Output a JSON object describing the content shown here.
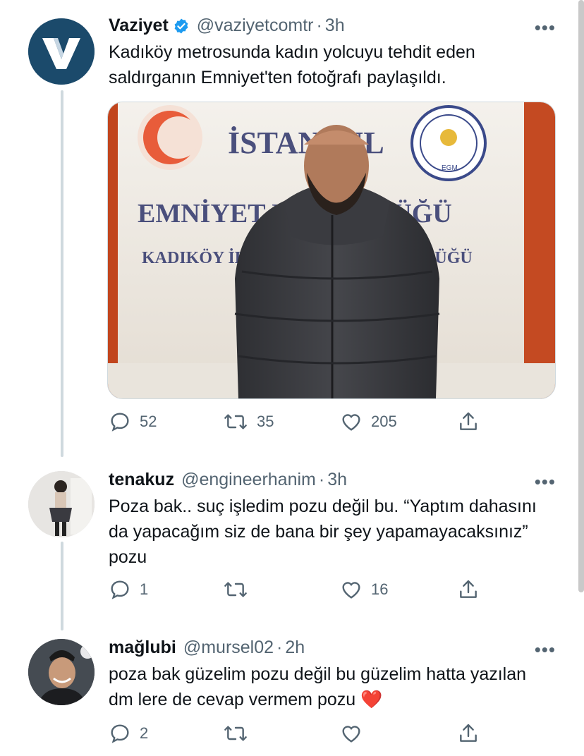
{
  "tweets": [
    {
      "name": "Vaziyet",
      "verified": true,
      "handle": "@vaziyetcomtr",
      "time": "3h",
      "text": "Kadıköy metrosunda kadın yolcuyu tehdit eden saldırganın Emniyet'ten fotoğrafı paylaşıldı.",
      "media": {
        "sign_line1": "İSTANBUL",
        "sign_line2": "EMNİYET MÜDÜRLÜĞÜ",
        "sign_line3": "KADIKÖY İLÇE EMNİYET MÜDÜRLÜĞÜ",
        "seal_text": "EGM"
      },
      "replies": "52",
      "retweets": "35",
      "likes": "205",
      "avatar_icon": "vaziyet-logo-icon",
      "avatar_color": "#1b4a6b"
    },
    {
      "name": "tenakuz",
      "verified": false,
      "handle": "@engineerhanim",
      "time": "3h",
      "text": "Poza bak.. suç işledim pozu değil bu. “Yaptım dahasını da yapacağım siz de bana bir şey yapamayacaksınız” pozu",
      "replies": "1",
      "retweets": "",
      "likes": "16"
    },
    {
      "name": "mağlubi",
      "verified": false,
      "handle": "@mursel02",
      "time": "2h",
      "text": "poza bak güzelim pozu değil bu güzelim hatta yazılan dm lere de cevap vermem pozu",
      "emoji": "❤️",
      "replies": "2",
      "retweets": "",
      "likes": ""
    }
  ],
  "more_label": "•••",
  "colors": {
    "accent": "#1d9bf0",
    "muted": "#536471",
    "thread": "#cfd9de"
  }
}
